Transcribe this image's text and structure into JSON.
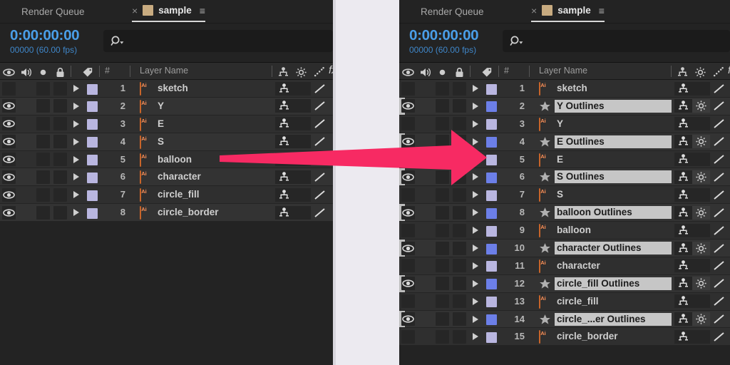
{
  "app": "Adobe After Effects Timeline",
  "colors": {
    "accent_timecode": "#4a9ee8",
    "arrow": "#F72A63",
    "ai_icon_border": "#c8652a",
    "selected_row_label_bg": "#c6c6c6",
    "layer_swatch_normal": "#b9b6e0",
    "layer_swatch_selected": "#6c7fe8",
    "panel_bg": "#232323",
    "gap_bg": "#ECEAF0"
  },
  "panels": [
    {
      "id": "before",
      "tabs": {
        "render_queue": "Render Queue",
        "close": "×",
        "comp_name": "sample",
        "menu": "≡"
      },
      "timecode": {
        "current": "0:00:00:00",
        "frames_fps": "00000 (60.00 fps)"
      },
      "search": {
        "placeholder": ""
      },
      "columns": {
        "video": "eye-icon",
        "audio": "speaker-icon",
        "solo": "solo-dot-icon",
        "lock": "lock-icon",
        "label": "tag-icon",
        "number": "#",
        "layer_name": "Layer Name",
        "switch_shy": "parent-switch-icon",
        "switch_rasterize": "continuous-rasterize-icon",
        "switch_quality": "quality-icon",
        "switch_fx": "fx"
      },
      "layers": [
        {
          "num": "1",
          "name": "sketch",
          "type": "ai",
          "visible": false,
          "selected": false,
          "rasterize": false
        },
        {
          "num": "2",
          "name": "Y",
          "type": "ai",
          "visible": true,
          "selected": false,
          "rasterize": false
        },
        {
          "num": "3",
          "name": "E",
          "type": "ai",
          "visible": true,
          "selected": false,
          "rasterize": false
        },
        {
          "num": "4",
          "name": "S",
          "type": "ai",
          "visible": true,
          "selected": false,
          "rasterize": false
        },
        {
          "num": "5",
          "name": "balloon",
          "type": "ai",
          "visible": true,
          "selected": false,
          "rasterize": false
        },
        {
          "num": "6",
          "name": "character",
          "type": "ai",
          "visible": true,
          "selected": false,
          "rasterize": false
        },
        {
          "num": "7",
          "name": "circle_fill",
          "type": "ai",
          "visible": true,
          "selected": false,
          "rasterize": false
        },
        {
          "num": "8",
          "name": "circle_border",
          "type": "ai",
          "visible": true,
          "selected": false,
          "rasterize": false
        }
      ]
    },
    {
      "id": "after",
      "tabs": {
        "render_queue": "Render Queue",
        "close": "×",
        "comp_name": "sample",
        "menu": "≡"
      },
      "timecode": {
        "current": "0:00:00:00",
        "frames_fps": "00000 (60.00 fps)"
      },
      "search": {
        "placeholder": ""
      },
      "columns": {
        "video": "eye-icon",
        "audio": "speaker-icon",
        "solo": "solo-dot-icon",
        "lock": "lock-icon",
        "label": "tag-icon",
        "number": "#",
        "layer_name": "Layer Name",
        "switch_shy": "parent-switch-icon",
        "switch_rasterize": "continuous-rasterize-icon",
        "switch_quality": "quality-icon",
        "switch_fx": "fx"
      },
      "layers": [
        {
          "num": "1",
          "name": "sketch",
          "type": "ai",
          "visible": false,
          "selected": false,
          "rasterize": false
        },
        {
          "num": "2",
          "name": "Y Outlines",
          "type": "shape",
          "visible": true,
          "selected": true,
          "rasterize": true
        },
        {
          "num": "3",
          "name": "Y",
          "type": "ai",
          "visible": false,
          "selected": false,
          "rasterize": false
        },
        {
          "num": "4",
          "name": "E Outlines",
          "type": "shape",
          "visible": true,
          "selected": true,
          "rasterize": true
        },
        {
          "num": "5",
          "name": "E",
          "type": "ai",
          "visible": false,
          "selected": false,
          "rasterize": false
        },
        {
          "num": "6",
          "name": "S Outlines",
          "type": "shape",
          "visible": true,
          "selected": true,
          "rasterize": true
        },
        {
          "num": "7",
          "name": "S",
          "type": "ai",
          "visible": false,
          "selected": false,
          "rasterize": false
        },
        {
          "num": "8",
          "name": "balloon Outlines",
          "type": "shape",
          "visible": true,
          "selected": true,
          "rasterize": true
        },
        {
          "num": "9",
          "name": "balloon",
          "type": "ai",
          "visible": false,
          "selected": false,
          "rasterize": false
        },
        {
          "num": "10",
          "name": "character Outlines",
          "type": "shape",
          "visible": true,
          "selected": true,
          "rasterize": true
        },
        {
          "num": "11",
          "name": "character",
          "type": "ai",
          "visible": false,
          "selected": false,
          "rasterize": false
        },
        {
          "num": "12",
          "name": "circle_fill Outlines",
          "type": "shape",
          "visible": true,
          "selected": true,
          "rasterize": true
        },
        {
          "num": "13",
          "name": "circle_fill",
          "type": "ai",
          "visible": false,
          "selected": false,
          "rasterize": false
        },
        {
          "num": "14",
          "name": "circle_...er Outlines",
          "type": "shape",
          "visible": true,
          "selected": true,
          "rasterize": true
        },
        {
          "num": "15",
          "name": "circle_border",
          "type": "ai",
          "visible": false,
          "selected": false,
          "rasterize": false
        }
      ]
    }
  ],
  "annotation": {
    "arrow": "right-arrow-annotation"
  }
}
